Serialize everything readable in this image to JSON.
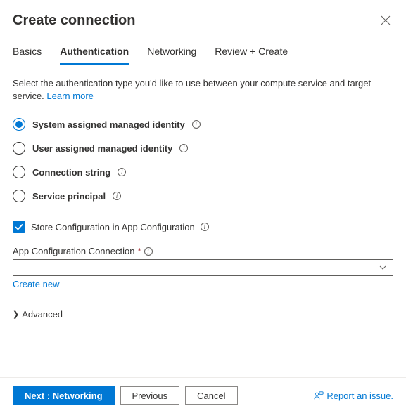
{
  "header": {
    "title": "Create connection"
  },
  "tabs": [
    {
      "label": "Basics",
      "active": false
    },
    {
      "label": "Authentication",
      "active": true
    },
    {
      "label": "Networking",
      "active": false
    },
    {
      "label": "Review + Create",
      "active": false
    }
  ],
  "description": "Select the authentication type you'd like to use between your compute service and target service. ",
  "learn_more": "Learn more",
  "auth_options": [
    {
      "label": "System assigned managed identity",
      "selected": true
    },
    {
      "label": "User assigned managed identity",
      "selected": false
    },
    {
      "label": "Connection string",
      "selected": false
    },
    {
      "label": "Service principal",
      "selected": false
    }
  ],
  "store_config": {
    "label": "Store Configuration in App Configuration",
    "checked": true
  },
  "app_config": {
    "label": "App Configuration Connection",
    "create_new": "Create new"
  },
  "advanced": {
    "label": "Advanced"
  },
  "footer": {
    "next": "Next : Networking",
    "previous": "Previous",
    "cancel": "Cancel",
    "report": "Report an issue."
  }
}
